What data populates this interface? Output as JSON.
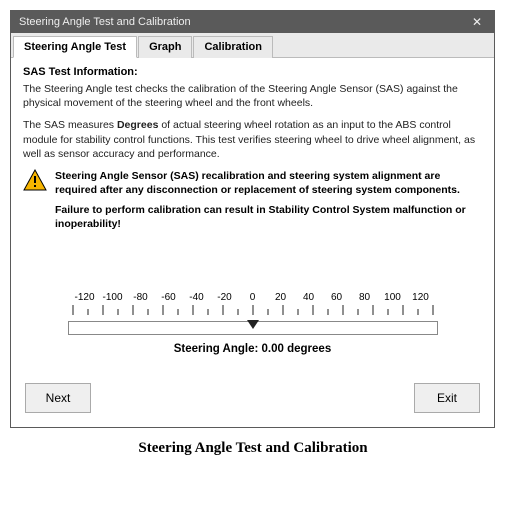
{
  "window": {
    "title": "Steering Angle Test and Calibration"
  },
  "tabs": [
    {
      "label": "Steering Angle Test",
      "active": true
    },
    {
      "label": "Graph",
      "active": false
    },
    {
      "label": "Calibration",
      "active": false
    }
  ],
  "info": {
    "heading": "SAS Test Information:",
    "p1": "The Steering Angle test checks the calibration of the Steering Angle Sensor (SAS) against the physical movement of the steering wheel and the front wheels.",
    "p2_pre": "The SAS measures ",
    "p2_bold": "Degrees",
    "p2_post": " of actual steering wheel rotation as an input to the ABS control module for stability control functions. This test verifies steering wheel to drive wheel alignment, as well as sensor accuracy and performance.",
    "warn1": "Steering Angle Sensor (SAS) recalibration and steering system alignment are required after any disconnection or replacement of steering system components.",
    "warn2": "Failure to perform calibration can result in Stability Control System malfunction or inoperability!"
  },
  "scale": {
    "ticks": [
      "-120",
      "-100",
      "-80",
      "-60",
      "-40",
      "-20",
      "0",
      "20",
      "40",
      "60",
      "80",
      "100",
      "120"
    ],
    "readout_prefix": "Steering Angle: ",
    "readout_value": "0.00",
    "readout_suffix": " degrees",
    "value_fraction": 0.5
  },
  "buttons": {
    "next": "Next",
    "exit": "Exit"
  },
  "caption": "Steering Angle Test and Calibration"
}
